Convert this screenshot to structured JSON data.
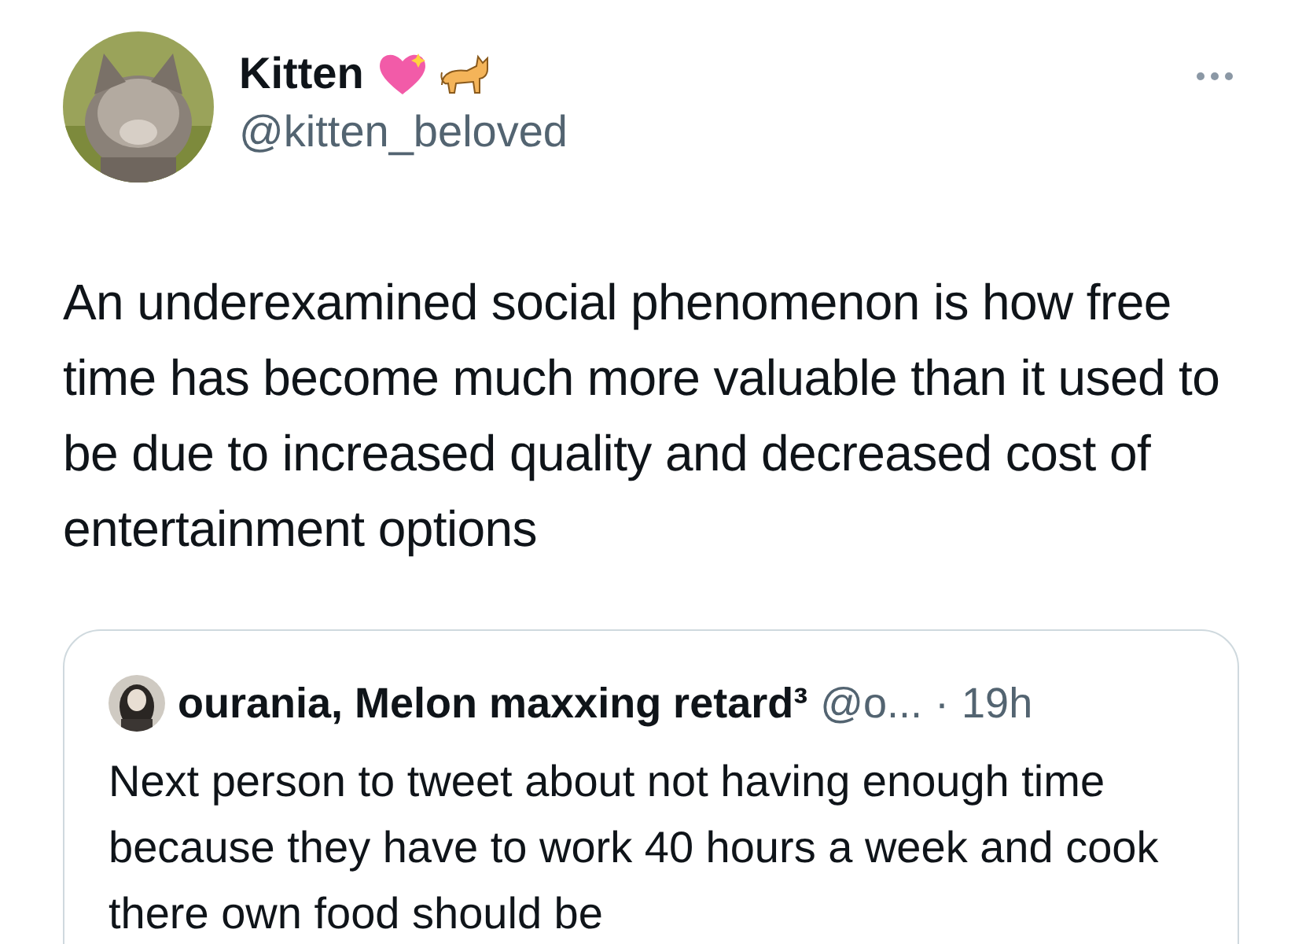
{
  "tweet": {
    "author": {
      "name": "Kitten",
      "handle": "@kitten_beloved"
    },
    "text": "An underexamined social phenomenon is how free time has become much more valuable than it used to be due to increased quality and decreased cost of entertainment options",
    "quote": {
      "author": {
        "name": "ourania, Melon maxxing retard³",
        "handle": "@o...",
        "separator": "·",
        "time": "19h"
      },
      "text": "Next person to tweet about not having enough time because they have to work 40 hours a week and cook there own food should be"
    }
  }
}
